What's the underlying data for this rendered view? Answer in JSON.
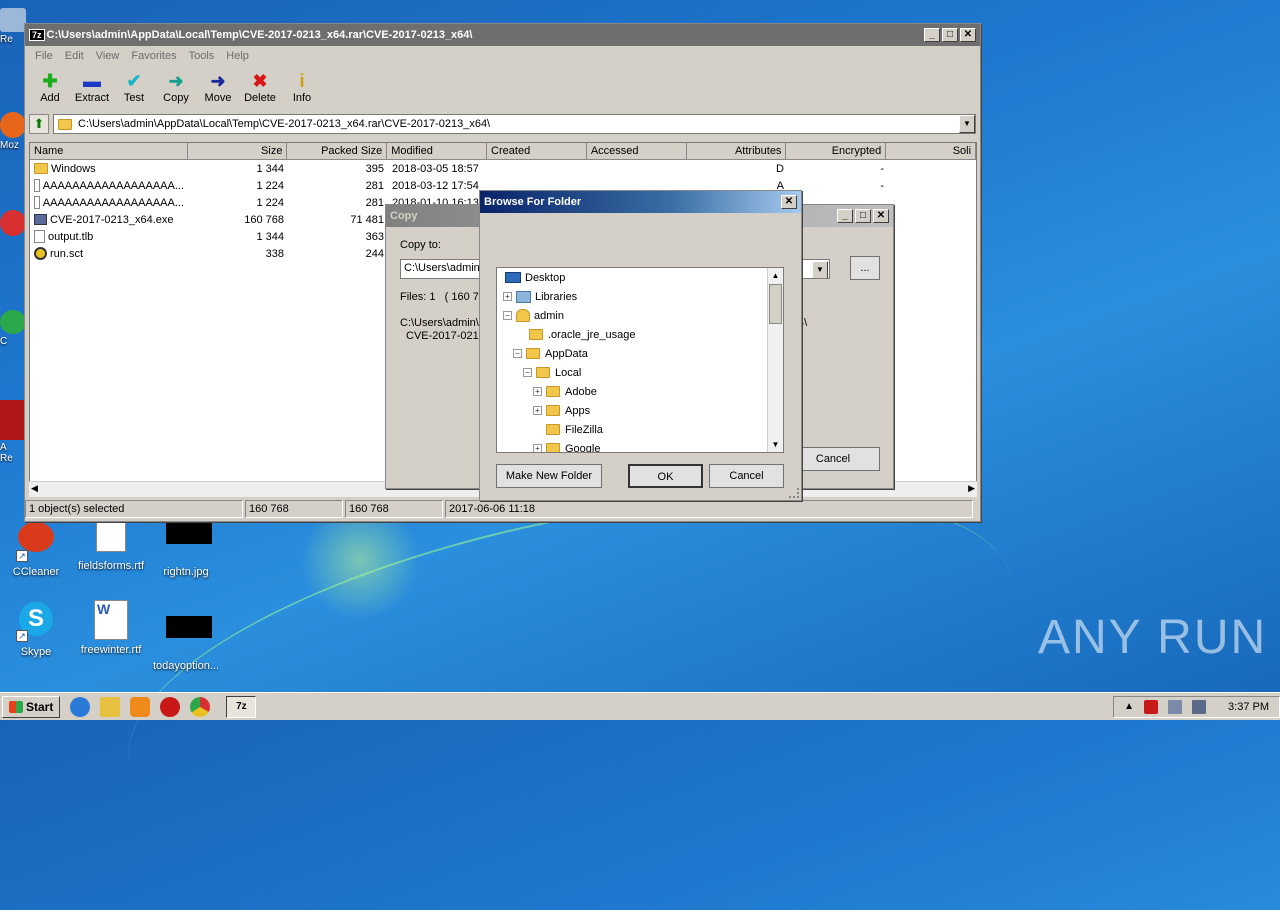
{
  "desktop": {
    "icons": [
      {
        "label": "CCleaner"
      },
      {
        "label": "fieldsforms.rtf"
      },
      {
        "label": "rightn.jpg"
      },
      {
        "label": "Skype"
      },
      {
        "label": "freewinter.rtf"
      },
      {
        "label": "todayoption..."
      }
    ],
    "edge_labels": [
      "Re",
      "Moz",
      "C",
      "A\nRe"
    ],
    "watermark": "ANY RUN"
  },
  "main_window": {
    "title": "C:\\Users\\admin\\AppData\\Local\\Temp\\CVE-2017-0213_x64.rar\\CVE-2017-0213_x64\\",
    "app_icon": "7z",
    "menu": [
      "File",
      "Edit",
      "View",
      "Favorites",
      "Tools",
      "Help"
    ],
    "toolbar": [
      {
        "label": "Add",
        "icon": "plus-icon",
        "color": "#1cae1c"
      },
      {
        "label": "Extract",
        "icon": "minus-icon",
        "color": "#1a3ac8"
      },
      {
        "label": "Test",
        "icon": "check-icon",
        "color": "#18b4c8"
      },
      {
        "label": "Copy",
        "icon": "arrow-right-icon",
        "color": "#18a090"
      },
      {
        "label": "Move",
        "icon": "arrow-right-icon",
        "color": "#1a2a9a"
      },
      {
        "label": "Delete",
        "icon": "x-icon",
        "color": "#d81818"
      },
      {
        "label": "Info",
        "icon": "info-icon",
        "color": "#c8a010"
      }
    ],
    "address": "C:\\Users\\admin\\AppData\\Local\\Temp\\CVE-2017-0213_x64.rar\\CVE-2017-0213_x64\\",
    "columns": [
      "Name",
      "Size",
      "Packed Size",
      "Modified",
      "Created",
      "Accessed",
      "Attributes",
      "Encrypted",
      "Soli"
    ],
    "rows": [
      {
        "name": "Windows",
        "size": "1 344",
        "packed": "395",
        "modified": "2018-03-05 18:57",
        "attributes": "D",
        "encrypted": "-",
        "icon": "folder"
      },
      {
        "name": "AAAAAAAAAAAAAAAAAA...",
        "size": "1 224",
        "packed": "281",
        "modified": "2018-03-12 17:54",
        "attributes": "A",
        "encrypted": "-",
        "icon": "file"
      },
      {
        "name": "AAAAAAAAAAAAAAAAAA...",
        "size": "1 224",
        "packed": "281",
        "modified": "2018-01-10 16:13",
        "attributes": "",
        "encrypted": "",
        "icon": "file"
      },
      {
        "name": "CVE-2017-0213_x64.exe",
        "size": "160 768",
        "packed": "71 481",
        "modified": "",
        "attributes": "",
        "encrypted": "",
        "icon": "exe"
      },
      {
        "name": "output.tlb",
        "size": "1 344",
        "packed": "363",
        "modified": "",
        "attributes": "",
        "encrypted": "",
        "icon": "file"
      },
      {
        "name": "run.sct",
        "size": "338",
        "packed": "244",
        "modified": "",
        "attributes": "",
        "encrypted": "",
        "icon": "script"
      }
    ],
    "status": [
      "1 object(s) selected",
      "160 768",
      "160 768",
      "2017-06-06 11:18"
    ]
  },
  "copy_dialog": {
    "title": "Copy",
    "copy_to_label": "Copy to:",
    "copy_to_value": "C:\\Users\\admin",
    "browse_label": "...",
    "files_label": "Files: 1",
    "files_size": "( 160 7",
    "path_line1": "C:\\Users\\admin\\",
    "path_line1_end": "4\\",
    "path_line2": "CVE-2017-0213",
    "cancel_label": "Cancel"
  },
  "browse_dialog": {
    "title": "Browse For Folder",
    "close_label": "✕",
    "tree": [
      {
        "label": "Desktop",
        "level": 0,
        "toggle": "",
        "icon": "desktop"
      },
      {
        "label": "Libraries",
        "level": 1,
        "toggle": "+",
        "icon": "library"
      },
      {
        "label": "admin",
        "level": 1,
        "toggle": "−",
        "icon": "user"
      },
      {
        "label": ".oracle_jre_usage",
        "level": 2,
        "toggle": "",
        "icon": "folder"
      },
      {
        "label": "AppData",
        "level": 2,
        "toggle": "−",
        "icon": "folder"
      },
      {
        "label": "Local",
        "level": 3,
        "toggle": "−",
        "icon": "folder"
      },
      {
        "label": "Adobe",
        "level": 4,
        "toggle": "+",
        "icon": "folder"
      },
      {
        "label": "Apps",
        "level": 4,
        "toggle": "+",
        "icon": "folder"
      },
      {
        "label": "FileZilla",
        "level": 4,
        "toggle": "",
        "icon": "folder"
      },
      {
        "label": "Google",
        "level": 4,
        "toggle": "+",
        "icon": "folder"
      }
    ],
    "new_folder_label": "Make New Folder",
    "ok_label": "OK",
    "cancel_label": "Cancel"
  },
  "taskbar": {
    "start_label": "Start",
    "clock": "3:37 PM",
    "task_label": "7z"
  }
}
